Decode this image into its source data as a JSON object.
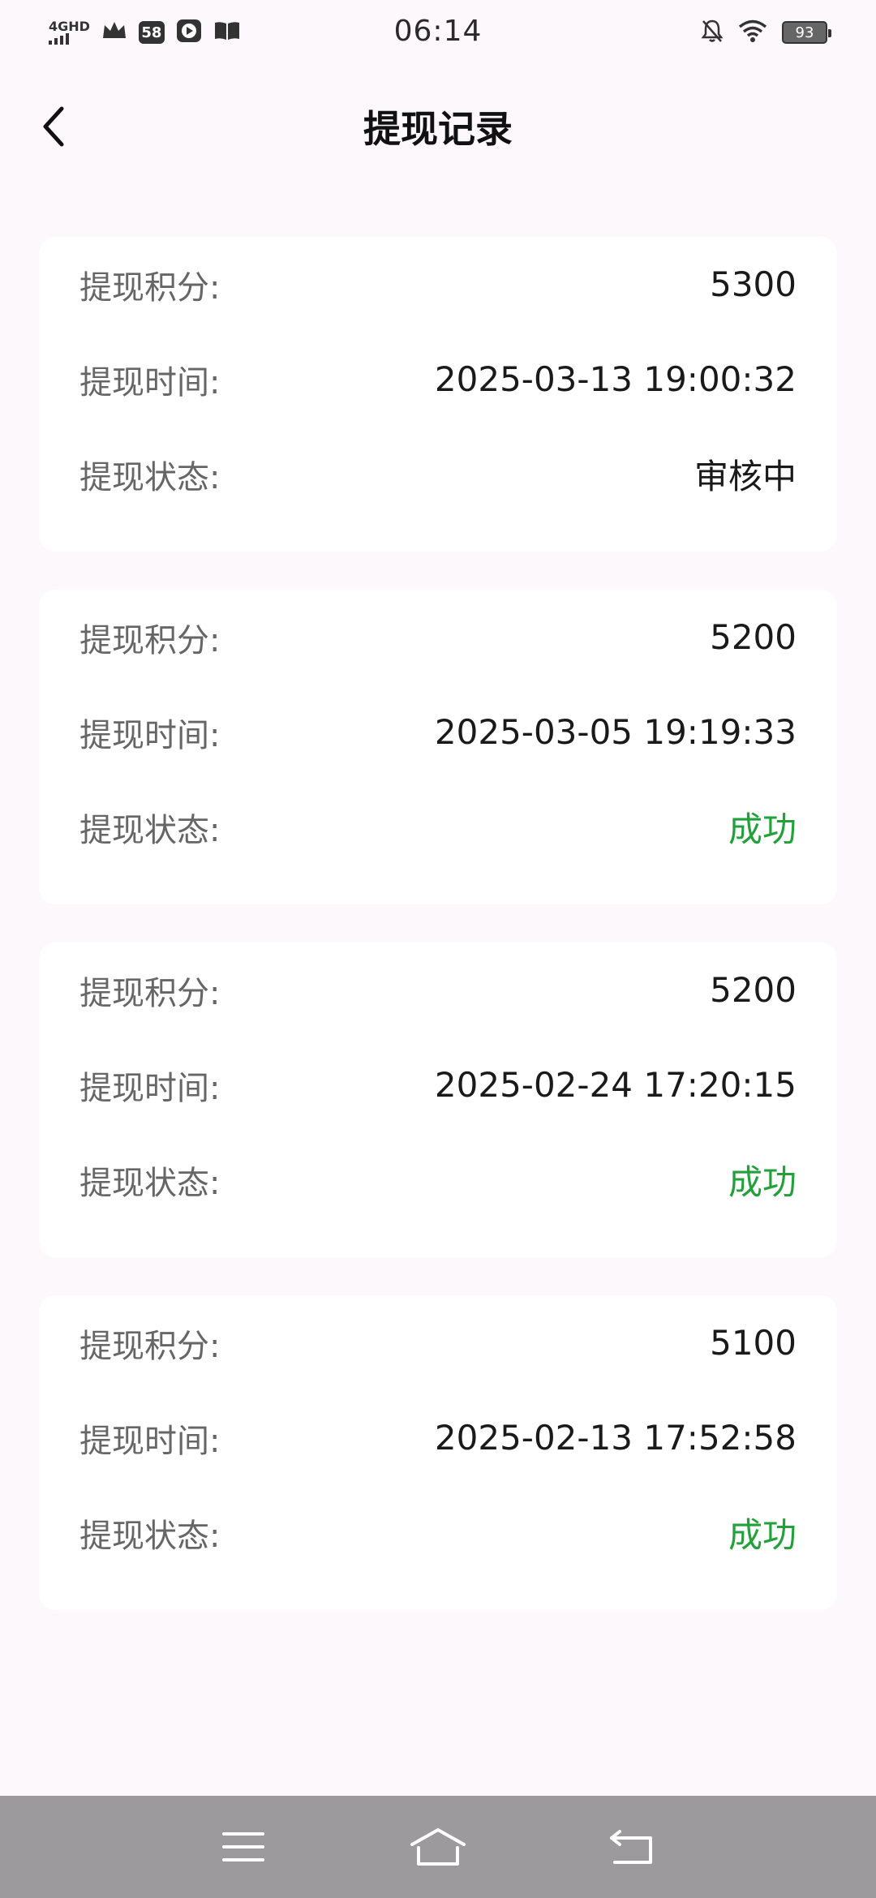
{
  "status_bar": {
    "time": "06:14",
    "network": "4GHD",
    "app_badge": "58",
    "battery": "93"
  },
  "header": {
    "title": "提现记录"
  },
  "records": [
    {
      "points_label": "提现积分:",
      "points": "5300",
      "time_label": "提现时间:",
      "time": "2025-03-13 19:00:32",
      "status_label": "提现状态:",
      "status": "审核中"
    },
    {
      "points_label": "提现积分:",
      "points": "5200",
      "time_label": "提现时间:",
      "time": "2025-03-05 19:19:33",
      "status_label": "提现状态:",
      "status": "成功"
    },
    {
      "points_label": "提现积分:",
      "points": "5200",
      "time_label": "提现时间:",
      "time": "2025-02-24 17:20:15",
      "status_label": "提现状态:",
      "status": "成功"
    },
    {
      "points_label": "提现积分:",
      "points": "5100",
      "time_label": "提现时间:",
      "time": "2025-02-13 17:52:58",
      "status_label": "提现状态:",
      "status": "成功"
    }
  ],
  "colors": {
    "success": "#22a03a",
    "background": "#fcf8fc",
    "nav_bar": "#9c9a9c"
  },
  "icons": {
    "back": "chevron-left-icon",
    "menu": "menu-icon",
    "home": "home-icon",
    "return": "return-icon"
  }
}
